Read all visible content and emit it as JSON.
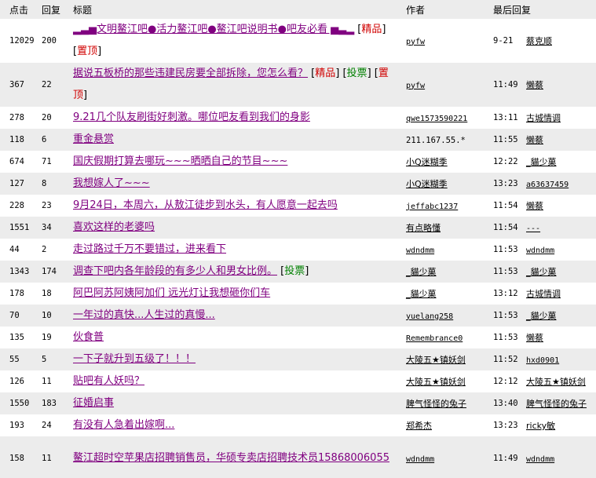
{
  "header": {
    "clicks": "点击",
    "replies": "回复",
    "title": "标题",
    "author": "作者",
    "last_reply": "最后回复"
  },
  "colors": {
    "link_visited": "#800080",
    "tag_red": "#d00000",
    "tag_green": "#008000",
    "row_alt": "#ececec"
  },
  "rows": [
    {
      "clicks": "12029",
      "replies": "200",
      "title": "▂▃▅文明鳌江吧●活力鳌江吧●鳌江吧说明书●吧友必看 ▅▃▂",
      "tags": [
        {
          "label": "精品",
          "color": "red"
        },
        {
          "label": "置顶",
          "color": "red"
        }
      ],
      "author": "pyfw",
      "time": "9-21",
      "last_user": "蔡克顺",
      "tall": true
    },
    {
      "clicks": "367",
      "replies": "22",
      "title": "据说五板桥的那些违建民房要全部拆除，您怎么看？",
      "tags": [
        {
          "label": "精品",
          "color": "red"
        },
        {
          "label": "投票",
          "color": "green"
        },
        {
          "label": "置顶",
          "color": "red"
        }
      ],
      "author": "pyfw",
      "time": "11:49",
      "last_user": "懒蔡",
      "tall": true
    },
    {
      "clicks": "278",
      "replies": "20",
      "title": "9.21几个队友刷街好刺激。哪位吧友看到我们的身影",
      "tags": [],
      "author": "qwe1573590221",
      "time": "13:11",
      "last_user": "古城情调"
    },
    {
      "clicks": "118",
      "replies": "6",
      "title": "重金悬赏",
      "tags": [],
      "author": "211.167.55.*",
      "author_plain": true,
      "time": "11:55",
      "last_user": "懒蔡"
    },
    {
      "clicks": "674",
      "replies": "71",
      "title": "国庆假期打算去哪玩~~~晒晒自己的节目~~~",
      "tags": [],
      "author": "小Q迷糊季",
      "time": "12:22",
      "last_user": "_貓少菓"
    },
    {
      "clicks": "127",
      "replies": "8",
      "title": "我想嫁人了~~~",
      "tags": [],
      "author": "小Q迷糊季",
      "time": "13:23",
      "last_user": "a63637459"
    },
    {
      "clicks": "228",
      "replies": "23",
      "title": "9月24日，本周六，从敖江徒步到水头，有人愿意一起去吗",
      "tags": [],
      "author": "jeffabc1237",
      "time": "11:54",
      "last_user": "懒蔡"
    },
    {
      "clicks": "1551",
      "replies": "34",
      "title": "喜欢这样的老婆吗",
      "tags": [],
      "author": "有点略懂",
      "time": "11:54",
      "last_user": "---"
    },
    {
      "clicks": "44",
      "replies": "2",
      "title": "走过路过千万不要错过，进来看下",
      "tags": [],
      "author": "wdndmm",
      "time": "11:53",
      "last_user": "wdndmm"
    },
    {
      "clicks": "1343",
      "replies": "174",
      "title": "调查下吧内各年龄段的有多少人和男女比例。",
      "tags": [
        {
          "label": "投票",
          "color": "green"
        }
      ],
      "author": "_貓少菓",
      "time": "11:53",
      "last_user": "_貓少菓"
    },
    {
      "clicks": "178",
      "replies": "18",
      "title": "阿巴阿苏阿姨阿加们 远光灯让我想砸你们车",
      "tags": [],
      "author": "_貓少菓",
      "time": "13:12",
      "last_user": "古城情调"
    },
    {
      "clicks": "70",
      "replies": "10",
      "title": "一年过的真快...人生过的真慢...",
      "tags": [],
      "author": "yuelang258",
      "time": "11:53",
      "last_user": "_貓少菓"
    },
    {
      "clicks": "135",
      "replies": "19",
      "title": "伙食普",
      "tags": [],
      "author": "Remembrance0",
      "time": "11:53",
      "last_user": "懒蔡"
    },
    {
      "clicks": "55",
      "replies": "5",
      "title": "一下子就升到五级了！！！",
      "tags": [],
      "author": "大陵五★镇妖剑",
      "time": "11:52",
      "last_user": "hxd0901"
    },
    {
      "clicks": "126",
      "replies": "11",
      "title": "贴吧有人妖吗？",
      "tags": [],
      "author": "大陵五★镇妖剑",
      "time": "12:12",
      "last_user": "大陵五★镇妖剑"
    },
    {
      "clicks": "1550",
      "replies": "183",
      "title": "征婚启事",
      "tags": [],
      "author": "脾气怪怪的兔子",
      "time": "13:40",
      "last_user": "脾气怪怪的兔子"
    },
    {
      "clicks": "193",
      "replies": "24",
      "title": "有没有人急着出嫁啊...",
      "tags": [],
      "author": "郑希杰",
      "time": "13:23",
      "last_user": "ricky敏"
    },
    {
      "clicks": "158",
      "replies": "11",
      "title": "鳌江超时空苹果店招聘销售员，华硕专卖店招聘技术员15868006055",
      "tags": [],
      "author": "wdndmm",
      "time": "11:49",
      "last_user": "wdndmm",
      "tall": true
    }
  ]
}
